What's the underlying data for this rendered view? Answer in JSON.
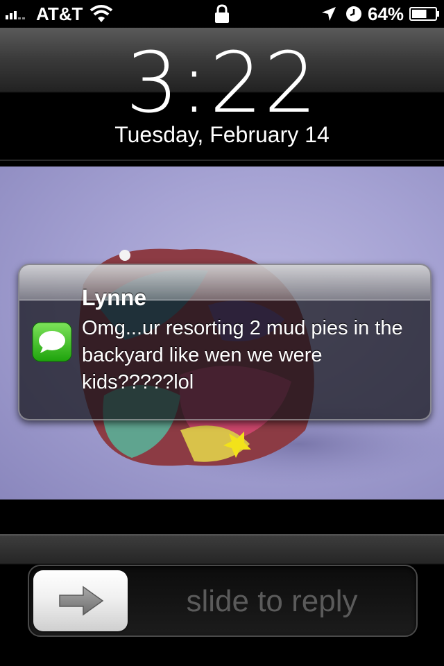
{
  "status_bar": {
    "carrier": "AT&T",
    "signal_bars": 3,
    "battery_percent": "64%",
    "battery_level": 0.64,
    "icons": [
      "signal-icon",
      "wifi-icon",
      "lock-icon",
      "location-icon",
      "clock-icon",
      "battery-icon"
    ]
  },
  "lock_screen": {
    "time": "3:22",
    "date": "Tuesday, February 14"
  },
  "notification": {
    "app_icon": "messages-icon",
    "sender": "Lynne",
    "message": "Omg...ur resorting 2 mud pies in the backyard like wen we were kids?????lol"
  },
  "slider": {
    "label": "slide to reply",
    "knob_icon": "arrow-right-icon"
  },
  "colors": {
    "messages_green": "#34c417",
    "wallpaper_bg": "#a5a2d3"
  }
}
